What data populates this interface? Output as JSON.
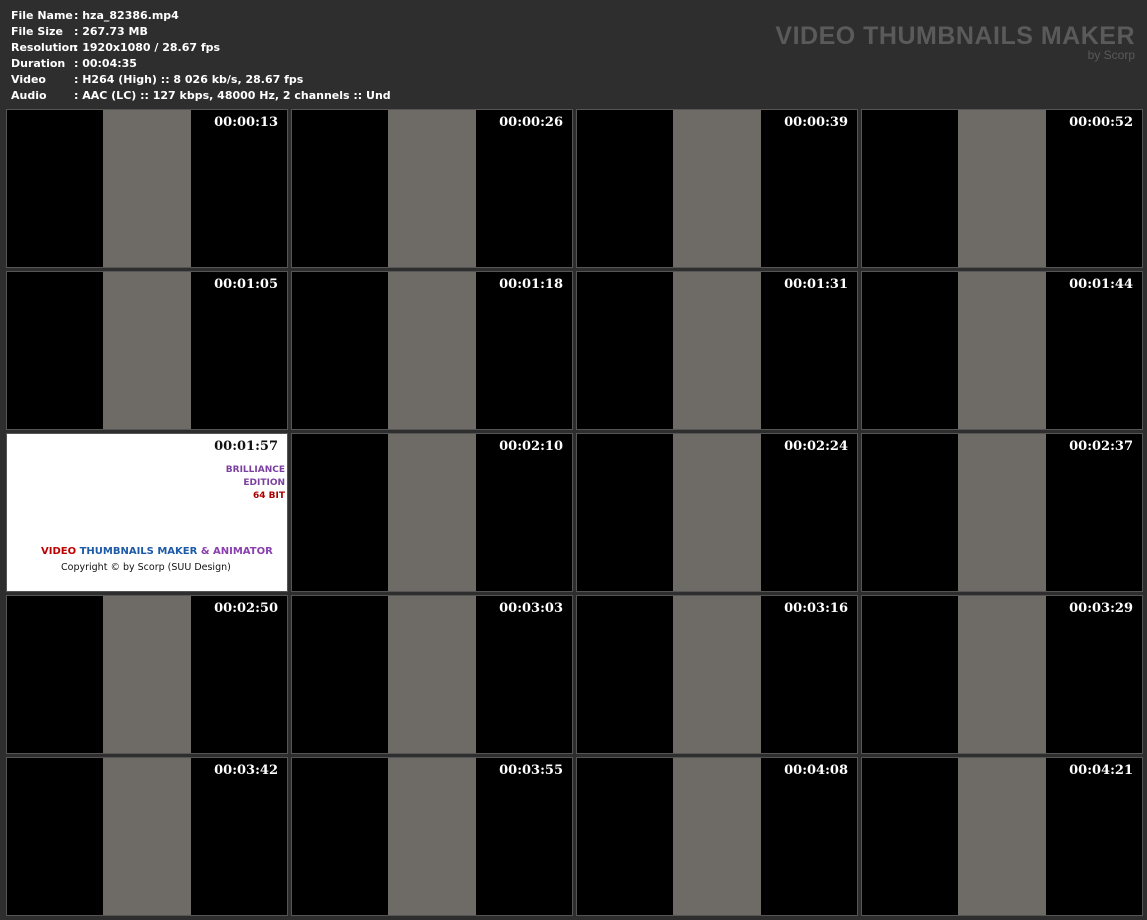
{
  "info": [
    {
      "label": "File Name",
      "value": ": hza_82386.mp4"
    },
    {
      "label": "File Size",
      "value": ": 267.73 MB"
    },
    {
      "label": "Resolution",
      "value": ": 1920x1080 / 28.67 fps"
    },
    {
      "label": "Duration",
      "value": ": 00:04:35"
    },
    {
      "label": "Video",
      "value": ": H264 (High) :: 8 026 kb/s, 28.67 fps"
    },
    {
      "label": "Audio",
      "value": ": AAC (LC) :: 127 kbps, 48000 Hz, 2 channels :: Und"
    }
  ],
  "brand": {
    "title": "VIDEO THUMBNAILS MAKER",
    "subtitle": "by Scorp"
  },
  "thumbnails": [
    "00:00:13",
    "00:00:26",
    "00:00:39",
    "00:00:52",
    "00:01:05",
    "00:01:18",
    "00:01:31",
    "00:01:44",
    "00:01:57",
    "00:02:10",
    "00:02:24",
    "00:02:37",
    "00:02:50",
    "00:03:03",
    "00:03:16",
    "00:03:29",
    "00:03:42",
    "00:03:55",
    "00:04:08",
    "00:04:21"
  ],
  "logo_tile": {
    "line1a": "VIDEO ",
    "line1b": "THUMBNAILS MAKER ",
    "line1c": "& ANIMATOR",
    "line2": "Copyright © by Scorp (SUU Design)",
    "edition1": "BRILLIANCE",
    "edition2": "EDITION",
    "edition3": "64 BIT"
  }
}
